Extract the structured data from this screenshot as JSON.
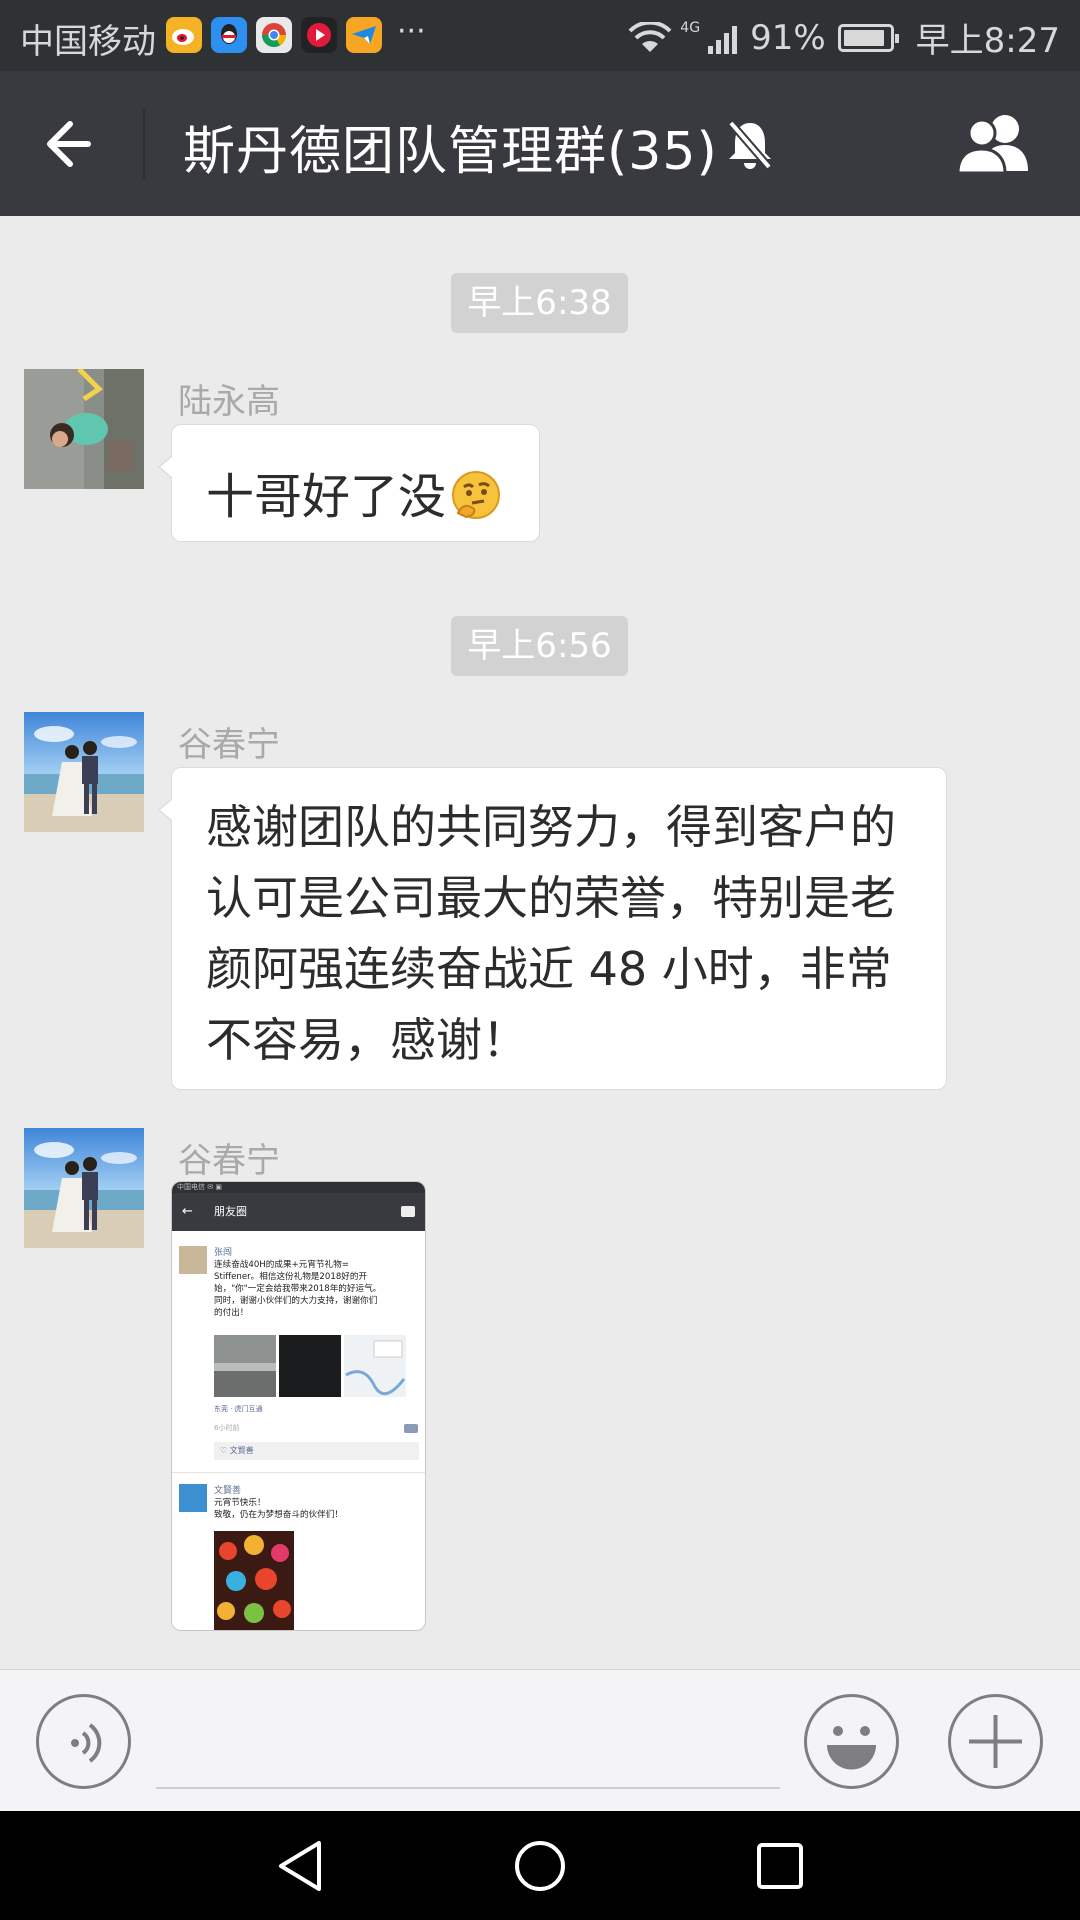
{
  "status_bar": {
    "carrier": "中国移动",
    "app_icons": [
      "weibo-icon",
      "qq-icon",
      "chrome-icon",
      "video-app-icon",
      "mail-app-icon"
    ],
    "more": "···",
    "network": "4G",
    "battery": "91%",
    "battery_level": 0.91,
    "time": "早上8:27"
  },
  "header": {
    "title": "斯丹德团队管理群(35)",
    "muted": true
  },
  "messages": [
    {
      "time": "早上6:38",
      "sender": "陆永高",
      "text": "十哥好了没"
    },
    {
      "time": "早上6:56",
      "sender": "谷春宁",
      "text_lines": [
        "感谢团队的共同努力，得到客户的",
        "认可是公司最大的荣誉，特别是老",
        "颜阿强连续奋战近 48 小时，非常",
        "不容易，感谢！"
      ]
    },
    {
      "sender": "谷春宁",
      "type": "image"
    }
  ],
  "shared_image": {
    "status": "中国电信 ✉ ▣",
    "title": "朋友圈",
    "post1": {
      "name": "张闯",
      "lines": [
        "连续奋战40H的成果+元宵节礼物=",
        "Stiffener。相信这份礼物是2018好的开",
        "始，\"你\"一定会给我带来2018年的好运气。",
        "同时，谢谢小伙伴们的大力支持，谢谢你们",
        "的付出！"
      ],
      "location": "东莞 · 虎门互通",
      "time": "6小时前",
      "likes": "♡ 文賢善"
    },
    "post2": {
      "name": "文賢善",
      "lines": [
        "元宵节快乐！",
        "致敬，仍在为梦想奋斗的伙伴们！"
      ]
    }
  },
  "colors": {
    "title_bar": "#393a3f",
    "status_bar": "#2f3235",
    "chat_bg": "#ebebeb",
    "bubble": "#ffffff"
  }
}
